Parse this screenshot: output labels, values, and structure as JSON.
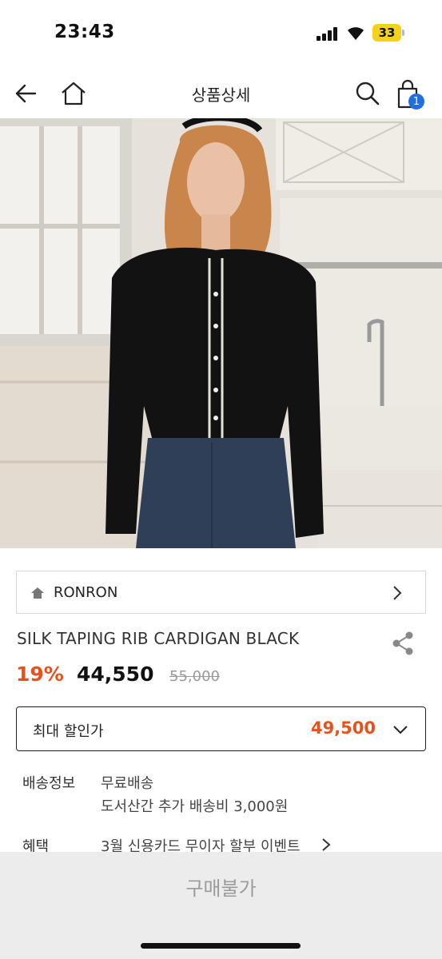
{
  "status": {
    "time": "23:43",
    "battery": "33"
  },
  "nav": {
    "title": "상품상세",
    "cart_count": "1"
  },
  "brand": {
    "name": "RONRON"
  },
  "product": {
    "name": "SILK TAPING RIB CARDIGAN BLACK",
    "discount": "19%",
    "sale_price": "44,550",
    "original_price": "55,000"
  },
  "max_discount": {
    "label": "최대 할인가",
    "price": "49,500"
  },
  "shipping": {
    "label": "배송정보",
    "line1": "무료배송",
    "line2": "도서산간 추가 배송비 3,000원"
  },
  "benefit": {
    "label": "혜택",
    "text": "3월 신용카드 무이자 할부 이벤트"
  },
  "buy": {
    "label": "구매불가"
  },
  "colors": {
    "accent": "#e8521a",
    "badge": "#1f6fe0"
  }
}
